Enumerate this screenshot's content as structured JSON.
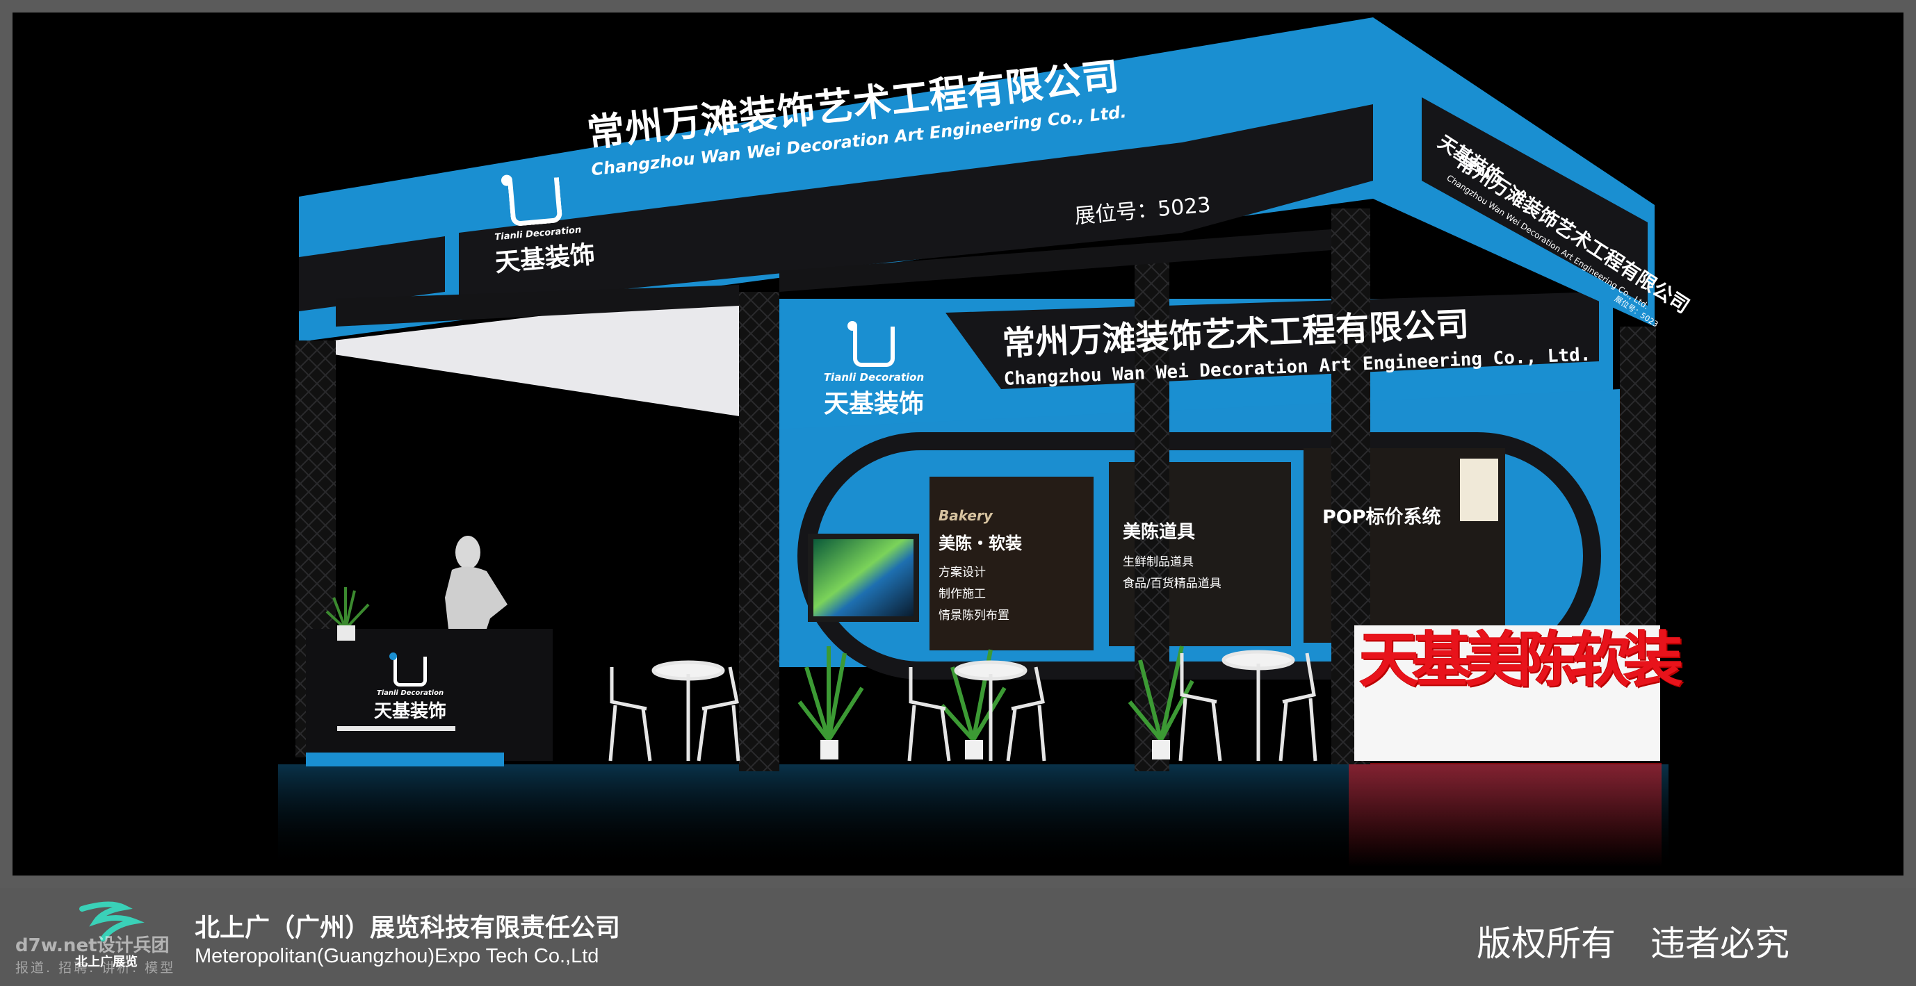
{
  "booth": {
    "company_cn": "常州万滩装饰艺术工程有限公司",
    "company_en": "Changzhou Wan Wei Decoration Art Engineering Co., Ltd.",
    "booth_no": "展位号：5023",
    "side_booth_no": "展位号：5023",
    "logo_en": "Tianli Decoration",
    "logo_cn": "天基装饰",
    "signage_big": "天基美陈软装",
    "panels": [
      {
        "title_en": "Bakery",
        "title": "美陈・软装",
        "lines": [
          "方案设计",
          "制作施工",
          "情景陈列布置"
        ]
      },
      {
        "title": "美陈道具",
        "lines": [
          "生鲜制品道具",
          "食品/百货精品道具"
        ]
      },
      {
        "title": "POP标价系统",
        "lines": []
      }
    ]
  },
  "footer": {
    "company_cn": "北上广（广州）展览科技有限责任公司",
    "company_en": "Meteropolitan(Guangzhou)Expo Tech Co.,Ltd",
    "logo_caption": "北上广展览",
    "copyright": "版权所有　违者必究",
    "watermark_site": "d7w.net设计兵团",
    "watermark_sub": "报道. 招聘. 讲析. 模型"
  },
  "colors": {
    "booth_blue": "#1a8fd1",
    "fascia_dark": "#1c1c1e",
    "signage_red": "#e8131b",
    "footer_bg": "#595959",
    "logo_green": "#3ad1b8"
  }
}
